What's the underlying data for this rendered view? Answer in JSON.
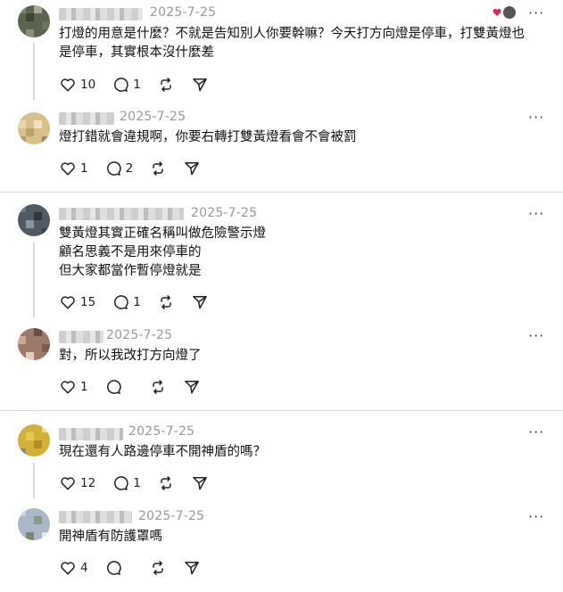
{
  "comments": [
    {
      "date": "2025-7-25",
      "text": [
        "打燈的用意是什麼？不就是告知別人你要幹嘛？今天打方向燈是停車，打雙黃燈也",
        "是停車，其實根本沒什麼差"
      ],
      "likes": "10",
      "replies": "1"
    },
    {
      "date": "2025-7-25",
      "text": [
        "燈打錯就會違規啊，你要右轉打雙黃燈看會不會被罰"
      ],
      "likes": "1",
      "replies": "2"
    },
    {
      "date": "2025-7-25",
      "text": [
        "雙黃燈其實正確名稱叫做危險警示燈",
        "顧名思義不是用來停車的",
        "但大家都當作暫停燈就是"
      ],
      "likes": "15",
      "replies": "1"
    },
    {
      "date": "2025-7-25",
      "text": [
        "對，所以我改打方向燈了"
      ],
      "likes": "1",
      "replies": ""
    },
    {
      "date": "2025-7-25",
      "text": [
        "現在還有人路邊停車不開神盾的嗎？"
      ],
      "likes": "12",
      "replies": "1"
    },
    {
      "date": "2025-7-25",
      "text": [
        "開神盾有防護罩嗎"
      ],
      "likes": "4",
      "replies": ""
    }
  ],
  "more_label": "···",
  "colors": {
    "heart": "#e0245e",
    "text": "#111111",
    "meta": "#999999"
  }
}
